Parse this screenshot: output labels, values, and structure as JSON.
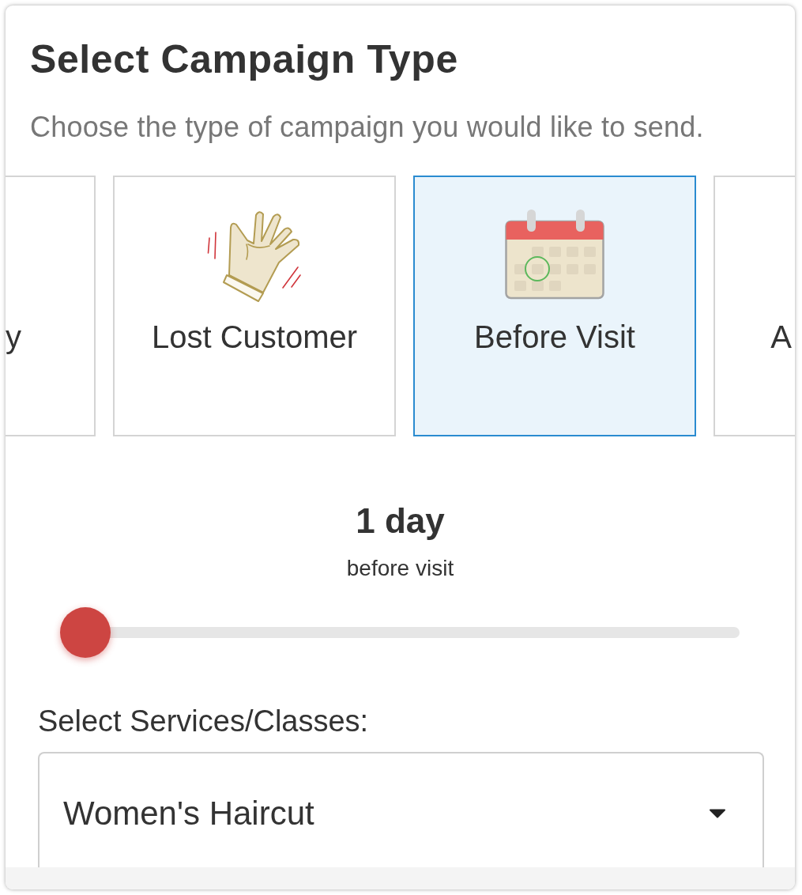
{
  "header": {
    "title": "Select Campaign Type",
    "subtitle": "Choose the type of campaign you would like to send."
  },
  "campaign_types": [
    {
      "label": "y",
      "kind": "partial_start",
      "selected": false
    },
    {
      "label": "Lost Customer",
      "kind": "full",
      "selected": false
    },
    {
      "label": "Before Visit",
      "kind": "full",
      "selected": true
    },
    {
      "label": "A",
      "kind": "partial_end",
      "selected": false
    }
  ],
  "timing": {
    "value": "1 day",
    "caption": "before visit",
    "level": 0
  },
  "services": {
    "label": "Select Services/Classes:",
    "value": "Women's Haircut"
  }
}
